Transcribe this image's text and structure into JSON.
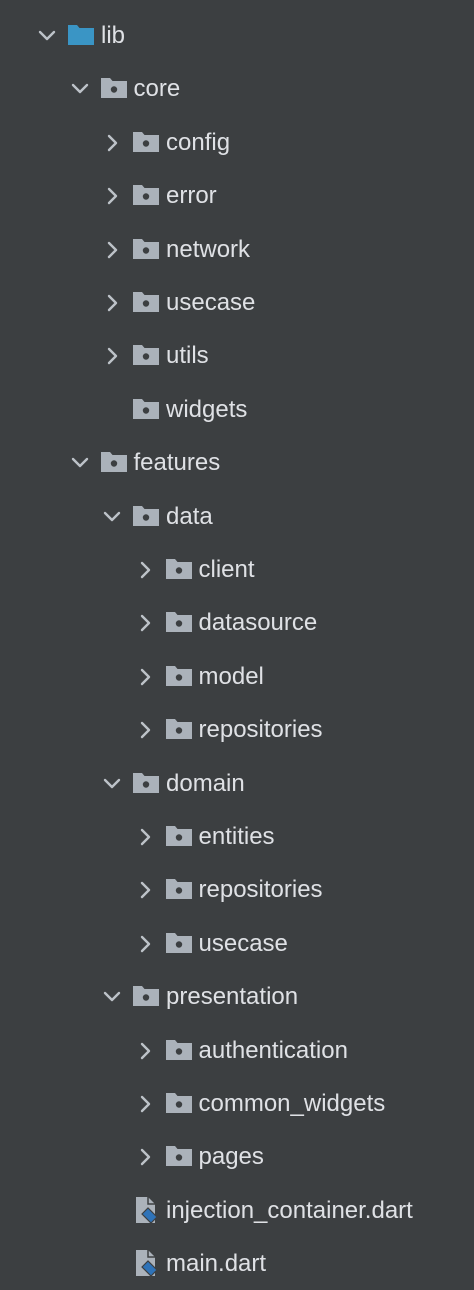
{
  "colors": {
    "background": "#3c3f41",
    "text": "#dfe1e5",
    "chevron": "#bdc2c8",
    "folder": "#abb2ba",
    "source_folder": "#3a95c5",
    "dart_icon": "#2f73b8"
  },
  "tree": [
    {
      "label": "lib",
      "depth": 0,
      "chevron": "expanded",
      "icon": "source-folder-icon"
    },
    {
      "label": "core",
      "depth": 1,
      "chevron": "expanded",
      "icon": "package-folder-icon"
    },
    {
      "label": "config",
      "depth": 2,
      "chevron": "collapsed",
      "icon": "package-folder-icon"
    },
    {
      "label": "error",
      "depth": 2,
      "chevron": "collapsed",
      "icon": "package-folder-icon"
    },
    {
      "label": "network",
      "depth": 2,
      "chevron": "collapsed",
      "icon": "package-folder-icon"
    },
    {
      "label": "usecase",
      "depth": 2,
      "chevron": "collapsed",
      "icon": "package-folder-icon"
    },
    {
      "label": "utils",
      "depth": 2,
      "chevron": "collapsed",
      "icon": "package-folder-icon"
    },
    {
      "label": "widgets",
      "depth": 2,
      "chevron": "none",
      "icon": "package-folder-icon"
    },
    {
      "label": "features",
      "depth": 1,
      "chevron": "expanded",
      "icon": "package-folder-icon"
    },
    {
      "label": "data",
      "depth": 2,
      "chevron": "expanded",
      "icon": "package-folder-icon"
    },
    {
      "label": "client",
      "depth": 3,
      "chevron": "collapsed",
      "icon": "package-folder-icon"
    },
    {
      "label": "datasource",
      "depth": 3,
      "chevron": "collapsed",
      "icon": "package-folder-icon"
    },
    {
      "label": "model",
      "depth": 3,
      "chevron": "collapsed",
      "icon": "package-folder-icon"
    },
    {
      "label": "repositories",
      "depth": 3,
      "chevron": "collapsed",
      "icon": "package-folder-icon"
    },
    {
      "label": "domain",
      "depth": 2,
      "chevron": "expanded",
      "icon": "package-folder-icon"
    },
    {
      "label": "entities",
      "depth": 3,
      "chevron": "collapsed",
      "icon": "package-folder-icon"
    },
    {
      "label": "repositories",
      "depth": 3,
      "chevron": "collapsed",
      "icon": "package-folder-icon"
    },
    {
      "label": "usecase",
      "depth": 3,
      "chevron": "collapsed",
      "icon": "package-folder-icon"
    },
    {
      "label": "presentation",
      "depth": 2,
      "chevron": "expanded",
      "icon": "package-folder-icon"
    },
    {
      "label": "authentication",
      "depth": 3,
      "chevron": "collapsed",
      "icon": "package-folder-icon"
    },
    {
      "label": "common_widgets",
      "depth": 3,
      "chevron": "collapsed",
      "icon": "package-folder-icon"
    },
    {
      "label": "pages",
      "depth": 3,
      "chevron": "collapsed",
      "icon": "package-folder-icon"
    },
    {
      "label": "injection_container.dart",
      "depth": 2,
      "chevron": "none",
      "icon": "dart-file-icon"
    },
    {
      "label": "main.dart",
      "depth": 2,
      "chevron": "none",
      "icon": "dart-file-icon"
    }
  ]
}
